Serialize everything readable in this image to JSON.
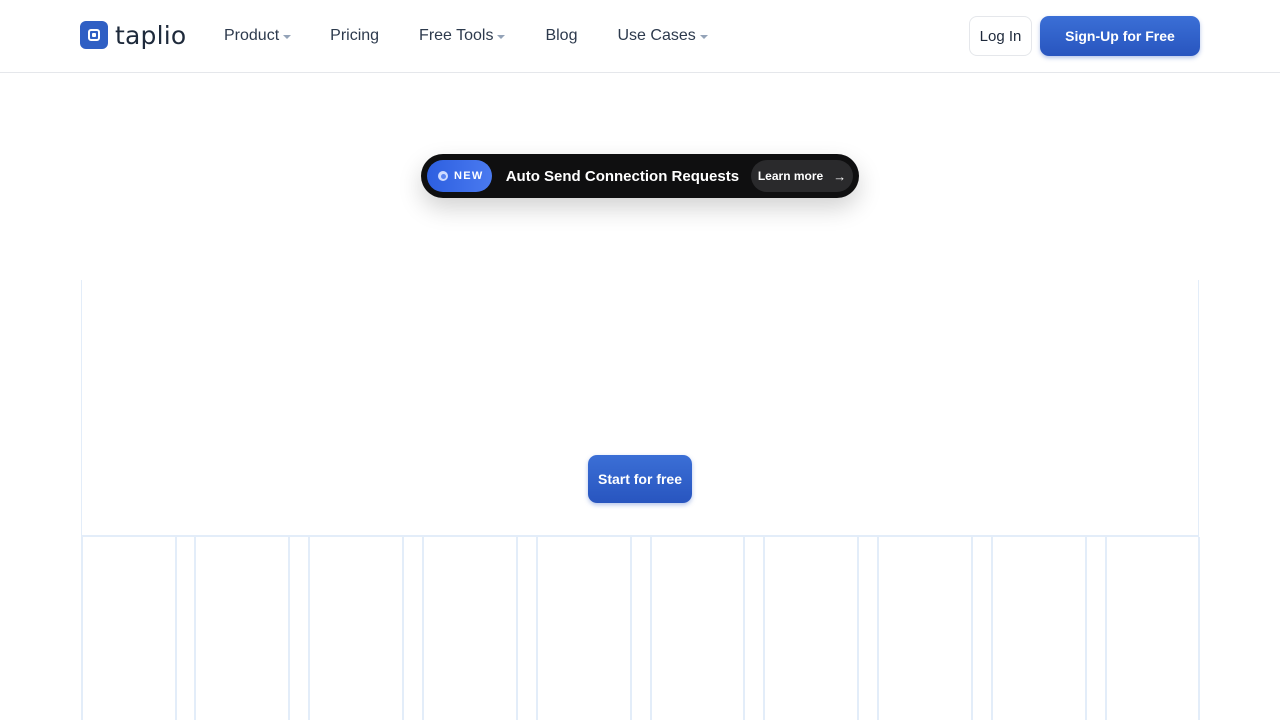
{
  "header": {
    "logo_text": "taplio",
    "nav": [
      {
        "label": "Product",
        "has_dropdown": true
      },
      {
        "label": "Pricing",
        "has_dropdown": false
      },
      {
        "label": "Free Tools",
        "has_dropdown": true
      },
      {
        "label": "Blog",
        "has_dropdown": false
      },
      {
        "label": "Use Cases",
        "has_dropdown": true
      }
    ],
    "login_label": "Log In",
    "signup_label": "Sign-Up for Free"
  },
  "announcement": {
    "badge": "NEW",
    "text": "Auto Send Connection Requests",
    "cta": "Learn more",
    "cta_icon": "arrow-right-icon"
  },
  "hero": {
    "cta_label": "Start for free"
  },
  "colors": {
    "brand_blue": "#2f5fc4",
    "announce_bg": "#0f0f10",
    "grid_line": "#e3edf9"
  }
}
